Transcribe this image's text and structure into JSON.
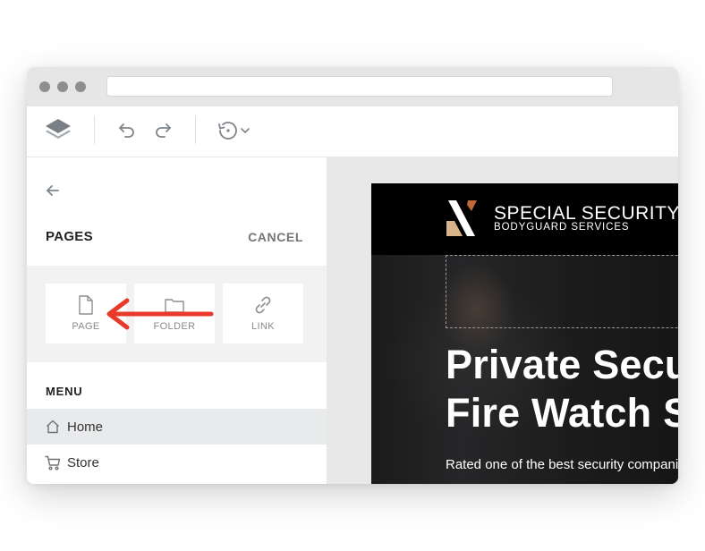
{
  "toolbar": {
    "icons": [
      "layers-icon",
      "undo-icon",
      "redo-icon",
      "history-icon",
      "chevron-down-icon"
    ]
  },
  "sidebar": {
    "title": "PAGES",
    "cancel_label": "CANCEL",
    "add_options": [
      {
        "label": "PAGE",
        "icon": "page-icon"
      },
      {
        "label": "FOLDER",
        "icon": "folder-icon"
      },
      {
        "label": "LINK",
        "icon": "link-icon"
      }
    ],
    "menu_title": "MENU",
    "menu_items": [
      {
        "label": "Home",
        "icon": "home-icon",
        "selected": true
      },
      {
        "label": "Store",
        "icon": "cart-icon",
        "selected": false
      }
    ]
  },
  "preview": {
    "brand_name": "SPECIAL SECURITY",
    "brand_tagline": "BODYGUARD SERVICES",
    "hero_title_line1": "Private Security &",
    "hero_title_line2": "Fire Watch Services",
    "hero_subtitle": "Rated one of the best security companies"
  },
  "colors": {
    "annotation_arrow": "#e8392b",
    "logo_accent": "#c06a3a",
    "logo_tan": "#d9b48a",
    "selected_row": "#e9eaeb"
  }
}
